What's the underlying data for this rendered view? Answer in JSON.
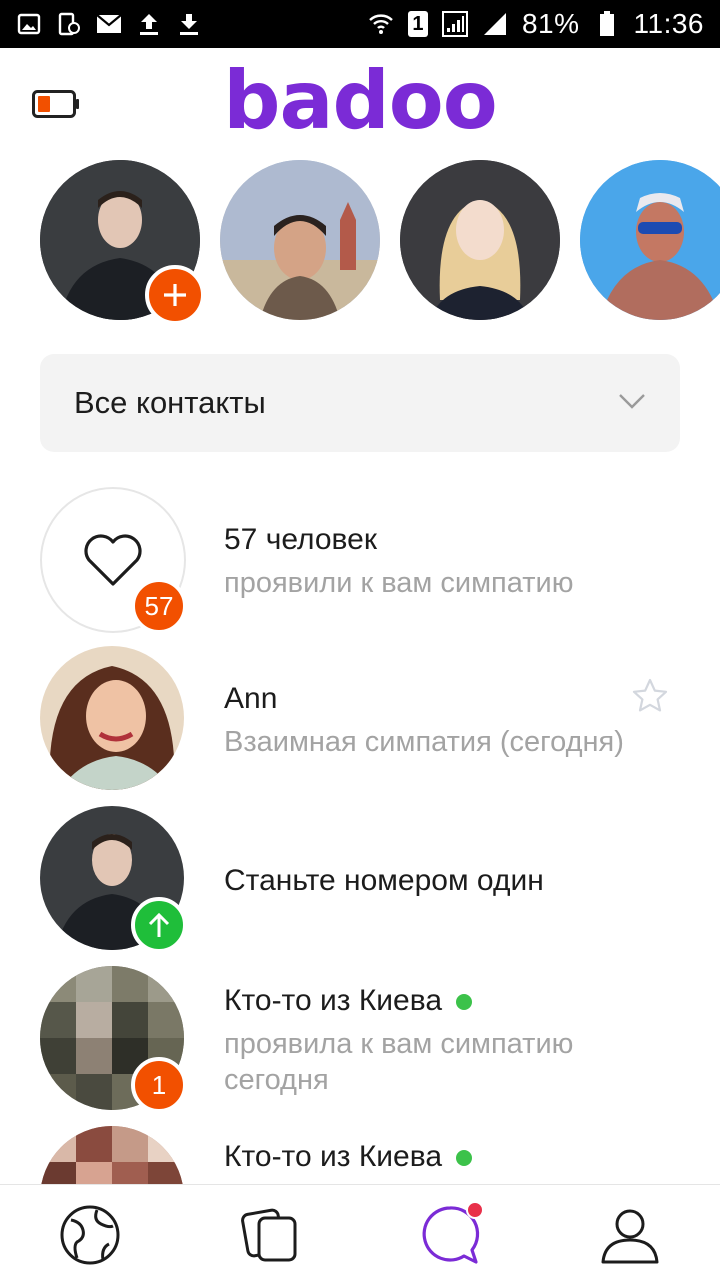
{
  "status_bar": {
    "battery_percent": "81%",
    "time": "11:36",
    "sim_label": "1"
  },
  "header": {
    "logo_text": "badoo",
    "low_battery_indicator": "battery-low-icon"
  },
  "stories": [
    {
      "name": "my-story",
      "has_add": true
    },
    {
      "name": "story-2"
    },
    {
      "name": "story-3"
    },
    {
      "name": "story-4"
    }
  ],
  "filter": {
    "label": "Все контакты",
    "icon": "chevron-down-icon"
  },
  "list": [
    {
      "title": "57 человек",
      "subtitle": "проявили к вам симпатию",
      "badge": "57",
      "icon": "heart-icon"
    },
    {
      "title": "Ann",
      "subtitle": "Взаимная симпатия (сегодня)",
      "action_icon": "star-icon"
    },
    {
      "title": "Станьте номером один",
      "badge_icon": "arrow-up-icon"
    },
    {
      "title": "Кто-то из Киева",
      "subtitle": "проявила к вам симпатию",
      "subtitle2": "сегодня",
      "badge": "1",
      "online": true
    },
    {
      "title": "Кто-то из Киева",
      "online": true
    }
  ],
  "bottom_nav": [
    "globe-icon",
    "cards-icon",
    "chat-icon",
    "profile-icon"
  ],
  "colors": {
    "brand": "#7b2bd6",
    "badge": "#f25000",
    "online": "#3cc24a",
    "up_badge": "#1fbe3a"
  }
}
